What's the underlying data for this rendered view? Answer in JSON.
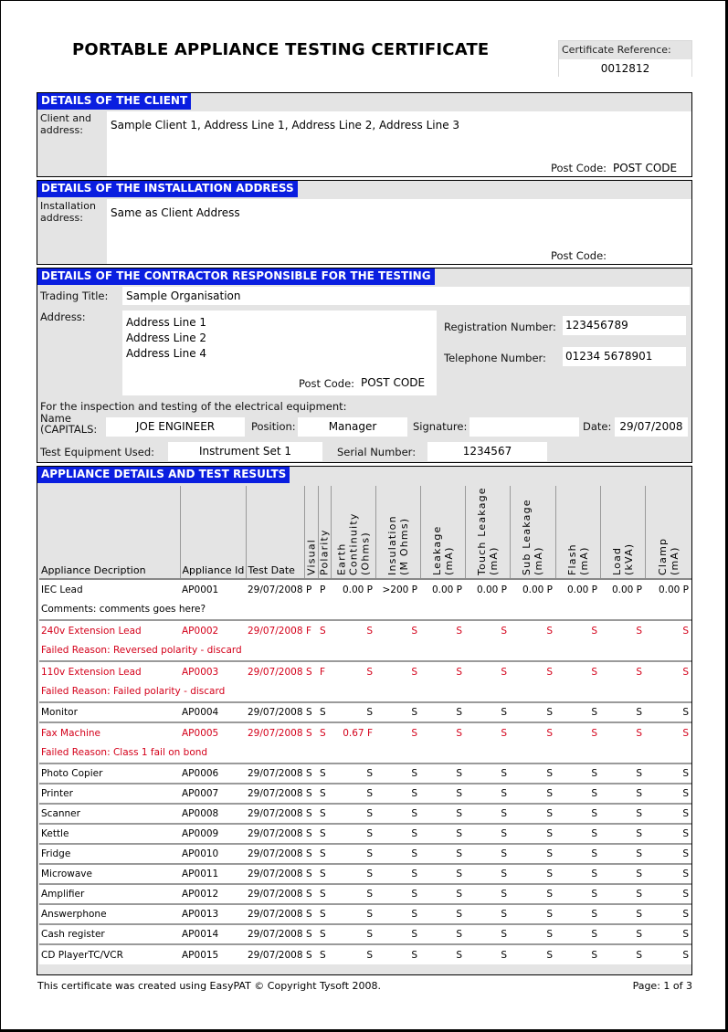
{
  "title": "PORTABLE APPLIANCE TESTING CERTIFICATE",
  "certificate_reference": {
    "label": "Certificate Reference:",
    "value": "0012812"
  },
  "client": {
    "heading": "DETAILS OF THE CLIENT",
    "label": "Client and address:",
    "address": "Sample Client 1, Address Line 1, Address Line 2, Address Line 3",
    "post_code_label": "Post Code:",
    "post_code": "POST CODE"
  },
  "installation": {
    "heading": "DETAILS OF THE INSTALLATION ADDRESS",
    "label": "Installation address:",
    "address": "Same as Client Address",
    "post_code_label": "Post Code:",
    "post_code": ""
  },
  "contractor": {
    "heading": "DETAILS OF THE CONTRACTOR RESPONSIBLE FOR THE TESTING",
    "trading_title_label": "Trading Title:",
    "trading_title": "Sample Organisation",
    "address_label": "Address:",
    "address_lines": [
      "Address Line 1",
      "Address Line 2",
      "Address Line 4"
    ],
    "post_code_label": "Post Code:",
    "post_code": "POST CODE",
    "registration_label": "Registration Number:",
    "registration": "123456789",
    "telephone_label": "Telephone Number:",
    "telephone": "01234 5678901",
    "inspection_text": "For the inspection and testing of the electrical equipment:",
    "name_label_1": "Name",
    "name_label_2": "(CAPITALS:",
    "name": "JOE ENGINEER",
    "position_label": "Position:",
    "position": "Manager",
    "signature_label": "Signature:",
    "signature": "",
    "date_label": "Date:",
    "date": "29/07/2008",
    "test_equipment_label": "Test Equipment Used:",
    "test_equipment": "Instrument Set 1",
    "serial_label": "Serial Number:",
    "serial": "1234567"
  },
  "appliances": {
    "heading": "APPLIANCE DETAILS AND TEST RESULTS",
    "columns": [
      "Appliance Decription",
      "Appliance Id",
      "Test Date",
      "Visual",
      "Polarity",
      "Earth Continuity (Ohms)",
      "Insulation (M Ohms)",
      "Leakage (mA)",
      "Touch Leakage (mA)",
      "Sub Leakage (mA)",
      "Flash (mA)",
      "Load (kVA)",
      "Clamp (mA)"
    ],
    "rows": [
      {
        "desc": "IEC Lead",
        "id": "AP0001",
        "date": "29/07/2008",
        "visual": "P",
        "polarity": "P",
        "earth": "0.00 P",
        "insulation": ">200 P",
        "leakage": "0.00 P",
        "touch": "0.00 P",
        "sub": "0.00 P",
        "flash": "0.00 P",
        "load": "0.00 P",
        "clamp": "0.00 P",
        "failed": false,
        "note": "Comments: comments goes here?"
      },
      {
        "desc": "240v Extension Lead",
        "id": "AP0002",
        "date": "29/07/2008",
        "visual": "F",
        "polarity": "S",
        "earth": "S",
        "insulation": "S",
        "leakage": "S",
        "touch": "S",
        "sub": "S",
        "flash": "S",
        "load": "S",
        "clamp": "S",
        "failed": true,
        "note": "Failed Reason: Reversed polarity - discard"
      },
      {
        "desc": "110v Extension Lead",
        "id": "AP0003",
        "date": "29/07/2008",
        "visual": "S",
        "polarity": "F",
        "earth": "S",
        "insulation": "S",
        "leakage": "S",
        "touch": "S",
        "sub": "S",
        "flash": "S",
        "load": "S",
        "clamp": "S",
        "failed": true,
        "note": "Failed Reason: Failed polarity - discard"
      },
      {
        "desc": "Monitor",
        "id": "AP0004",
        "date": "29/07/2008",
        "visual": "S",
        "polarity": "S",
        "earth": "S",
        "insulation": "S",
        "leakage": "S",
        "touch": "S",
        "sub": "S",
        "flash": "S",
        "load": "S",
        "clamp": "S",
        "failed": false,
        "note": ""
      },
      {
        "desc": "Fax Machine",
        "id": "AP0005",
        "date": "29/07/2008",
        "visual": "S",
        "polarity": "S",
        "earth": "0.67 F",
        "insulation": "S",
        "leakage": "S",
        "touch": "S",
        "sub": "S",
        "flash": "S",
        "load": "S",
        "clamp": "S",
        "failed": true,
        "note": "Failed Reason: Class 1 fail on bond"
      },
      {
        "desc": "Photo Copier",
        "id": "AP0006",
        "date": "29/07/2008",
        "visual": "S",
        "polarity": "S",
        "earth": "S",
        "insulation": "S",
        "leakage": "S",
        "touch": "S",
        "sub": "S",
        "flash": "S",
        "load": "S",
        "clamp": "S",
        "failed": false,
        "note": ""
      },
      {
        "desc": "Printer",
        "id": "AP0007",
        "date": "29/07/2008",
        "visual": "S",
        "polarity": "S",
        "earth": "S",
        "insulation": "S",
        "leakage": "S",
        "touch": "S",
        "sub": "S",
        "flash": "S",
        "load": "S",
        "clamp": "S",
        "failed": false,
        "note": ""
      },
      {
        "desc": "Scanner",
        "id": "AP0008",
        "date": "29/07/2008",
        "visual": "S",
        "polarity": "S",
        "earth": "S",
        "insulation": "S",
        "leakage": "S",
        "touch": "S",
        "sub": "S",
        "flash": "S",
        "load": "S",
        "clamp": "S",
        "failed": false,
        "note": ""
      },
      {
        "desc": "Kettle",
        "id": "AP0009",
        "date": "29/07/2008",
        "visual": "S",
        "polarity": "S",
        "earth": "S",
        "insulation": "S",
        "leakage": "S",
        "touch": "S",
        "sub": "S",
        "flash": "S",
        "load": "S",
        "clamp": "S",
        "failed": false,
        "note": ""
      },
      {
        "desc": "Fridge",
        "id": "AP0010",
        "date": "29/07/2008",
        "visual": "S",
        "polarity": "S",
        "earth": "S",
        "insulation": "S",
        "leakage": "S",
        "touch": "S",
        "sub": "S",
        "flash": "S",
        "load": "S",
        "clamp": "S",
        "failed": false,
        "note": ""
      },
      {
        "desc": "Microwave",
        "id": "AP0011",
        "date": "29/07/2008",
        "visual": "S",
        "polarity": "S",
        "earth": "S",
        "insulation": "S",
        "leakage": "S",
        "touch": "S",
        "sub": "S",
        "flash": "S",
        "load": "S",
        "clamp": "S",
        "failed": false,
        "note": ""
      },
      {
        "desc": "Amplifier",
        "id": "AP0012",
        "date": "29/07/2008",
        "visual": "S",
        "polarity": "S",
        "earth": "S",
        "insulation": "S",
        "leakage": "S",
        "touch": "S",
        "sub": "S",
        "flash": "S",
        "load": "S",
        "clamp": "S",
        "failed": false,
        "note": ""
      },
      {
        "desc": "Answerphone",
        "id": "AP0013",
        "date": "29/07/2008",
        "visual": "S",
        "polarity": "S",
        "earth": "S",
        "insulation": "S",
        "leakage": "S",
        "touch": "S",
        "sub": "S",
        "flash": "S",
        "load": "S",
        "clamp": "S",
        "failed": false,
        "note": ""
      },
      {
        "desc": "Cash register",
        "id": "AP0014",
        "date": "29/07/2008",
        "visual": "S",
        "polarity": "S",
        "earth": "S",
        "insulation": "S",
        "leakage": "S",
        "touch": "S",
        "sub": "S",
        "flash": "S",
        "load": "S",
        "clamp": "S",
        "failed": false,
        "note": ""
      },
      {
        "desc": "CD PlayerTC/VCR",
        "id": "AP0015",
        "date": "29/07/2008",
        "visual": "S",
        "polarity": "S",
        "earth": "S",
        "insulation": "S",
        "leakage": "S",
        "touch": "S",
        "sub": "S",
        "flash": "S",
        "load": "S",
        "clamp": "S",
        "failed": false,
        "note": ""
      }
    ]
  },
  "footer": {
    "copyright": "This certificate was created using EasyPAT © Copyright Tysoft 2008.",
    "page": "Page: 1 of 3"
  },
  "colors": {
    "header_blue": "#0a1ee0",
    "fail_red": "#d4001a",
    "panel_grey": "#e4e4e4"
  }
}
